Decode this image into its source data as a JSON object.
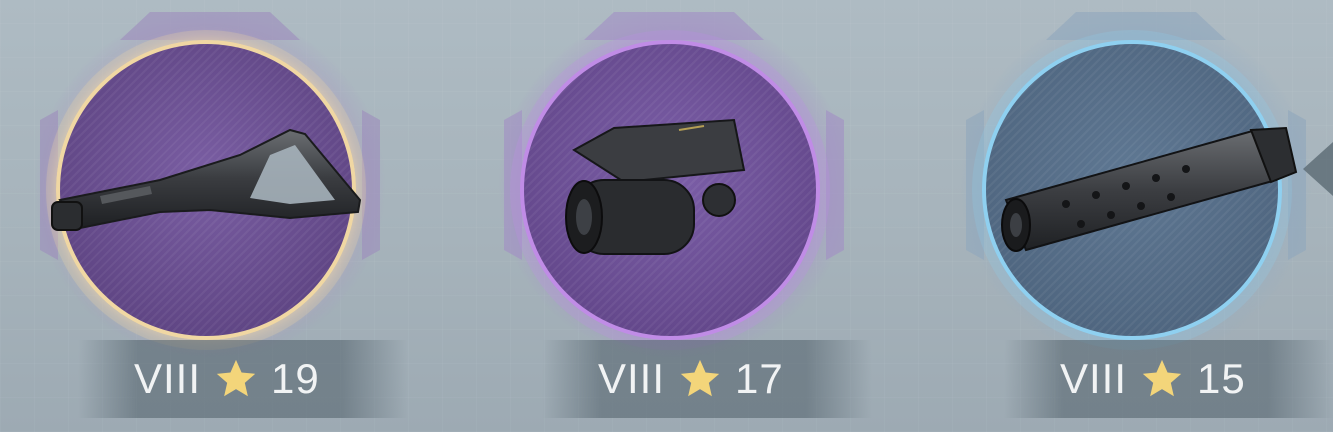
{
  "slots": [
    {
      "item_icon": "stock-icon",
      "tier": "VIII",
      "level": "19",
      "rarity_color": "#e9c98e",
      "disc_color": "#6b4f92"
    },
    {
      "item_icon": "laser-sight-icon",
      "tier": "VIII",
      "level": "17",
      "rarity_color": "#b67be0",
      "disc_color": "#6e4f95"
    },
    {
      "item_icon": "suppressor-icon",
      "tier": "VIII",
      "level": "15",
      "rarity_color": "#8fd0f0",
      "disc_color": "#546c87"
    }
  ],
  "colors": {
    "star": "#f3d57a",
    "scroll_arrow": "#5f6e78"
  },
  "icons": {
    "rating": "star-icon",
    "scroll": "arrow-left-icon"
  }
}
